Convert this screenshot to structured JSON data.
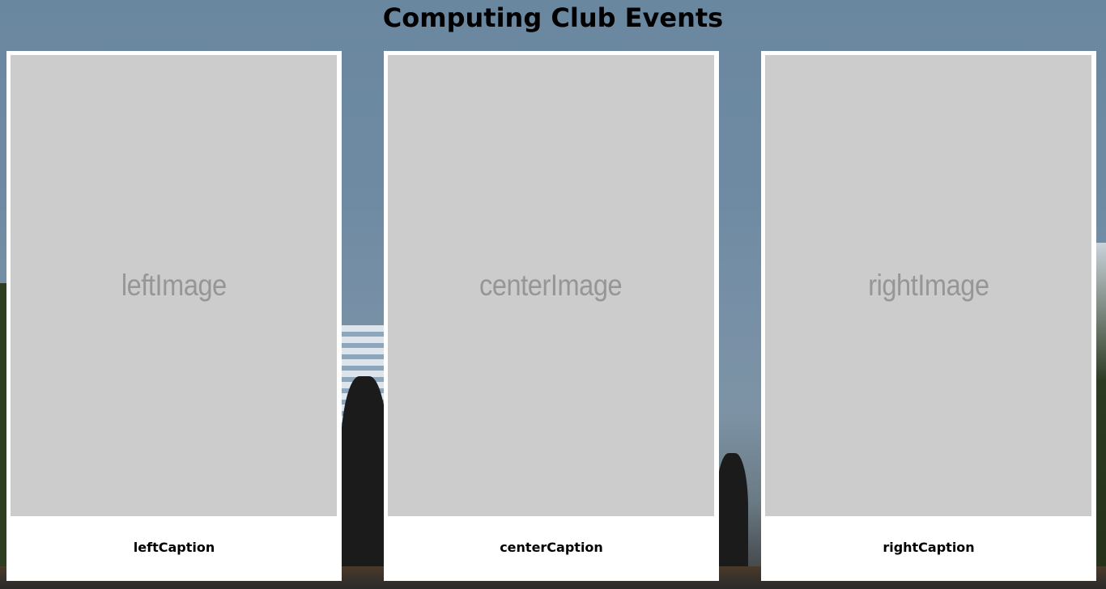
{
  "page": {
    "title": "Computing Club Events"
  },
  "cards": {
    "left": {
      "image_label": "leftImage",
      "caption": "leftCaption"
    },
    "center": {
      "image_label": "centerImage",
      "caption": "centerCaption"
    },
    "right": {
      "image_label": "rightImage",
      "caption": "rightCaption"
    }
  },
  "colors": {
    "placeholder_bg": "#cccccc",
    "placeholder_text": "#969696",
    "card_bg": "#ffffff"
  }
}
